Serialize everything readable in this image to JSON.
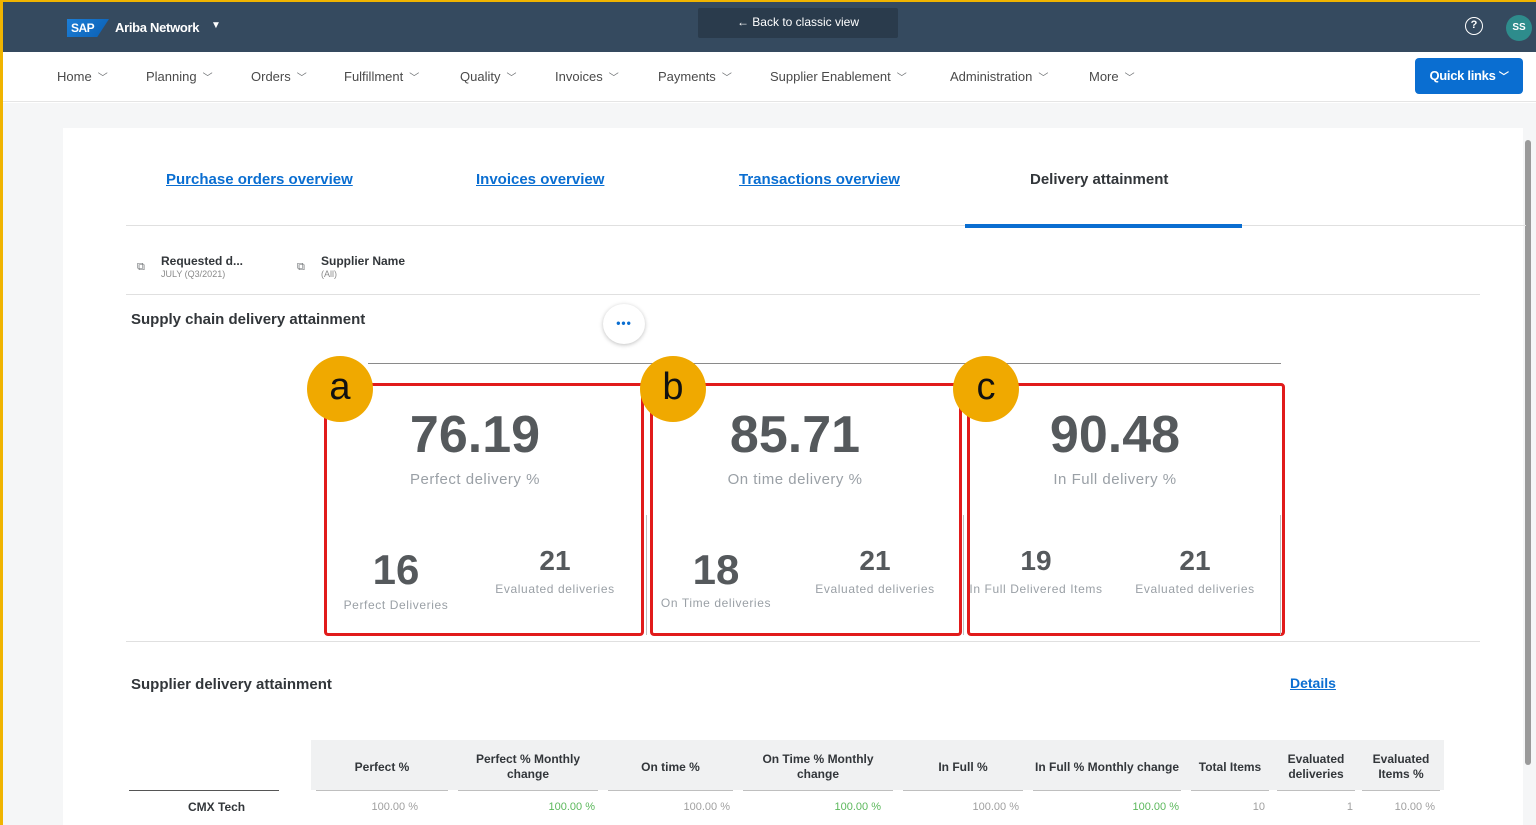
{
  "shell": {
    "logo": "SAP",
    "app_title": "Ariba Network",
    "back_classic": "← Back to classic view",
    "avatar_initials": "SS"
  },
  "nav": {
    "items": [
      "Home",
      "Planning",
      "Orders",
      "Fulfillment",
      "Quality",
      "Invoices",
      "Payments",
      "Supplier Enablement",
      "Administration",
      "More"
    ],
    "quick_links": "Quick links"
  },
  "tabs": {
    "purchase_orders": "Purchase orders overview",
    "invoices": "Invoices overview",
    "transactions": "Transactions overview",
    "delivery": "Delivery attainment"
  },
  "filters": {
    "requested_label": "Requested d...",
    "requested_value": "JULY (Q3/2021)",
    "supplier_label": "Supplier Name",
    "supplier_value": "(All)"
  },
  "supply_chain": {
    "title": "Supply chain delivery attainment",
    "more": "•••"
  },
  "kpis": [
    {
      "badge": "a",
      "value": "76.19",
      "label": "Perfect delivery %",
      "left_num": "16",
      "left_caption": "Perfect Deliveries",
      "right_num": "21",
      "right_caption": "Evaluated deliveries"
    },
    {
      "badge": "b",
      "value": "85.71",
      "label": "On time delivery %",
      "left_num": "18",
      "left_caption": "On Time deliveries",
      "right_num": "21",
      "right_caption": "Evaluated deliveries"
    },
    {
      "badge": "c",
      "value": "90.48",
      "label": "In Full delivery %",
      "left_num": "19",
      "left_caption": "In Full Delivered Items",
      "right_num": "21",
      "right_caption": "Evaluated deliveries"
    }
  ],
  "supplier": {
    "title": "Supplier delivery attainment",
    "details": "Details"
  },
  "table": {
    "headers": [
      "Perfect %",
      "Perfect % Monthly change",
      "On time %",
      "On Time % Monthly change",
      "In Full %",
      "In Full % Monthly change",
      "Total Items",
      "Evaluated deliveries",
      "Evaluated Items %"
    ],
    "rows": [
      {
        "name": "CMX Tech",
        "cells": [
          "100.00 %",
          "100.00 %",
          "100.00 %",
          "100.00 %",
          "100.00 %",
          "100.00 %",
          "10",
          "1",
          "10.00 %"
        ]
      }
    ]
  },
  "colors": {
    "shell": "#354a5f",
    "accent": "#0a6ed1",
    "highlight": "#e11b1b",
    "badge": "#f0a900",
    "positive": "#5cb85c"
  }
}
